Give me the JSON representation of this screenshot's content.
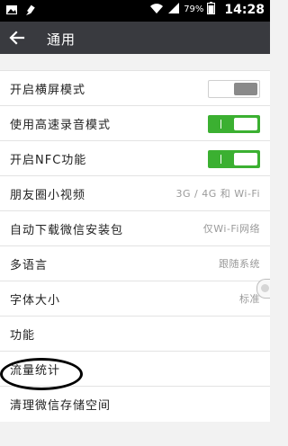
{
  "status_bar": {
    "battery_percent": "79%",
    "time": "14:28",
    "icons": [
      "image-icon",
      "brush-icon",
      "wifi-icon",
      "signal-icon",
      "battery-icon"
    ]
  },
  "app_bar": {
    "title": "通用",
    "back_icon": "back-arrow-icon"
  },
  "settings": {
    "items": [
      {
        "label": "开启横屏模式",
        "control": "toggle",
        "state": "off"
      },
      {
        "label": "使用高速录音模式",
        "control": "toggle",
        "state": "on"
      },
      {
        "label": "开启NFC功能",
        "control": "toggle",
        "state": "on"
      },
      {
        "label": "朋友圈小视频",
        "value": "3G / 4G 和 Wi-Fi"
      },
      {
        "label": "自动下载微信安装包",
        "value": "仅Wi-Fi网络"
      },
      {
        "label": "多语言",
        "value": "跟随系统"
      },
      {
        "label": "字体大小",
        "value": "标准"
      },
      {
        "label": "功能"
      },
      {
        "label": "流量统计"
      },
      {
        "label": "清理微信存储空间"
      }
    ]
  },
  "colors": {
    "status_bar": "#000000",
    "app_bar": "#393a3f",
    "toggle_on": "#3bb031",
    "annotation": "#000000"
  }
}
